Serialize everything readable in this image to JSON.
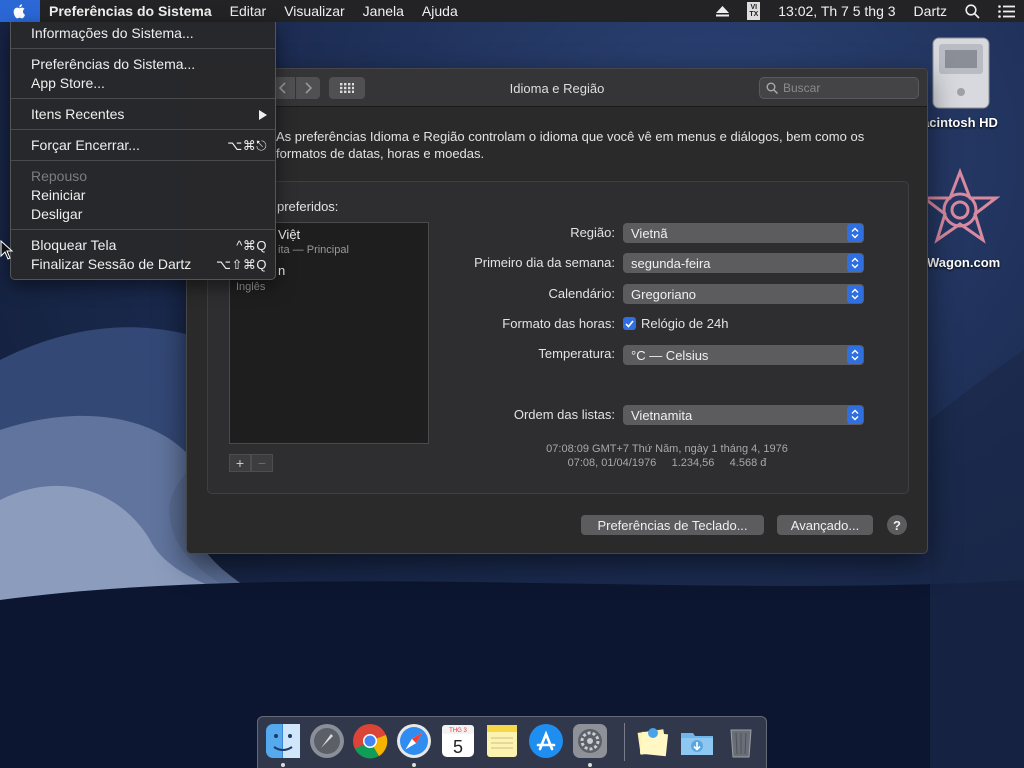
{
  "menubar": {
    "app_name": "Preferências do Sistema",
    "menus": [
      "Editar",
      "Visualizar",
      "Janela",
      "Ajuda"
    ],
    "ime_label_top": "VI",
    "ime_label_bottom": "TX",
    "clock": "13:02, Th 7 5 thg 3",
    "user": "Dartz"
  },
  "apple_menu": {
    "about": "Informações do Sistema...",
    "sys_prefs": "Preferências do Sistema...",
    "app_store": "App Store...",
    "recent_items": "Itens Recentes",
    "force_quit": "Forçar Encerrar...",
    "force_quit_shortcut": "⌥⌘⎋",
    "sleep": "Repouso",
    "restart": "Reiniciar",
    "shutdown": "Desligar",
    "lock_screen": "Bloquear Tela",
    "lock_shortcut": "^⌘Q",
    "logout": "Finalizar Sessão de Dartz",
    "logout_shortcut": "⌥⇧⌘Q"
  },
  "desktop": {
    "hd_label": "acintosh HD",
    "wagon_label": "aWagon.com"
  },
  "window": {
    "title": "Idioma e Região",
    "search_placeholder": "Buscar",
    "intro": "As preferências Idioma e Região controlam o idioma que você vê em menus e diálogos, bem como os formatos de datas, horas e moedas.",
    "languages_title": "preferidos:",
    "languages": [
      {
        "name": "Việt",
        "sub": "ita — Principal"
      },
      {
        "name": "n",
        "sub": "Inglês"
      }
    ],
    "labels": {
      "region": "Região:",
      "first_day": "Primeiro dia da semana:",
      "calendar": "Calendário:",
      "time_format": "Formato das horas:",
      "temperature": "Temperatura:",
      "list_order": "Ordem das listas:"
    },
    "values": {
      "region": "Vietnã",
      "first_day": "segunda-feira",
      "calendar": "Gregoriano",
      "clock_24h": "Relógio de 24h",
      "temperature": "°C — Celsius",
      "list_order": "Vietnamita"
    },
    "clock_24h_checked": true,
    "sample_line1": "07:08:09 GMT+7 Thứ Năm, ngày 1 tháng 4, 1976",
    "sample_line2": "07:08, 01/04/1976     1.234,56     4.568 đ",
    "keyboard_prefs_button": "Preferências de Teclado...",
    "advanced_button": "Avançado...",
    "help_label": "?",
    "plus": "+",
    "minus": "−"
  },
  "dock": {
    "apps": [
      "finder-icon",
      "launchpad-icon",
      "chrome-icon",
      "safari-icon",
      "calendar-icon",
      "notes-icon",
      "app-store-icon",
      "system-preferences-icon"
    ],
    "calendar_day": "5",
    "calendar_month": "THG 3"
  },
  "colors": {
    "accent": "#2f6fe0",
    "menubar": "#232325",
    "window_bg": "#2a2a2b"
  }
}
